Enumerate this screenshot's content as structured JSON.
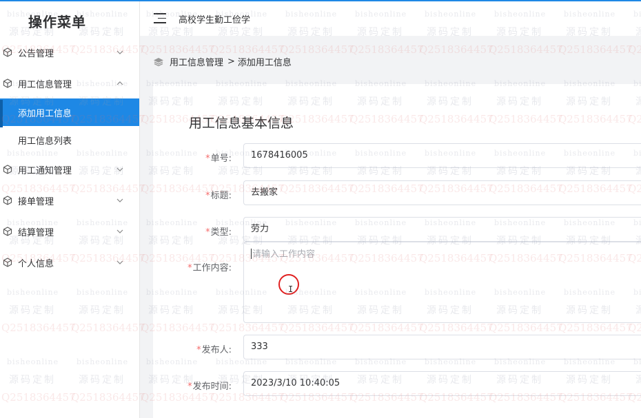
{
  "sidebar": {
    "title": "操作菜单",
    "menus": [
      {
        "label": "公告管理",
        "expanded": false
      },
      {
        "label": "用工信息管理",
        "expanded": true
      },
      {
        "label": "用工通知管理",
        "expanded": false
      },
      {
        "label": "接单管理",
        "expanded": false
      },
      {
        "label": "结算管理",
        "expanded": false
      },
      {
        "label": "个人信息",
        "expanded": false
      }
    ],
    "submenu": [
      {
        "label": "添加用工信息",
        "active": true
      },
      {
        "label": "用工信息列表",
        "active": false
      }
    ]
  },
  "header": {
    "app_title": "高校学生勤工俭学"
  },
  "breadcrumb": {
    "parent": "用工信息管理",
    "separator": ">",
    "current": "添加用工信息"
  },
  "form": {
    "title": "用工信息基本信息",
    "fields": [
      {
        "label": "单号:",
        "value": "1678416005"
      },
      {
        "label": "标题:",
        "value": "去搬家"
      },
      {
        "label": "类型:",
        "value": "劳力"
      },
      {
        "label": "工作内容:",
        "placeholder": "请输入工作内容"
      },
      {
        "label": "发布人:",
        "value": "333"
      },
      {
        "label": "发布时间:",
        "value": "2023/3/10 10:40:05"
      }
    ],
    "required_mark": "*"
  },
  "watermark": {
    "line1": "bisheonline",
    "line2": "源码定制",
    "line3": "Q2518364457"
  },
  "colors": {
    "accent": "#1e88e5",
    "required": "#f56c6c",
    "click_ring": "#e02020"
  }
}
